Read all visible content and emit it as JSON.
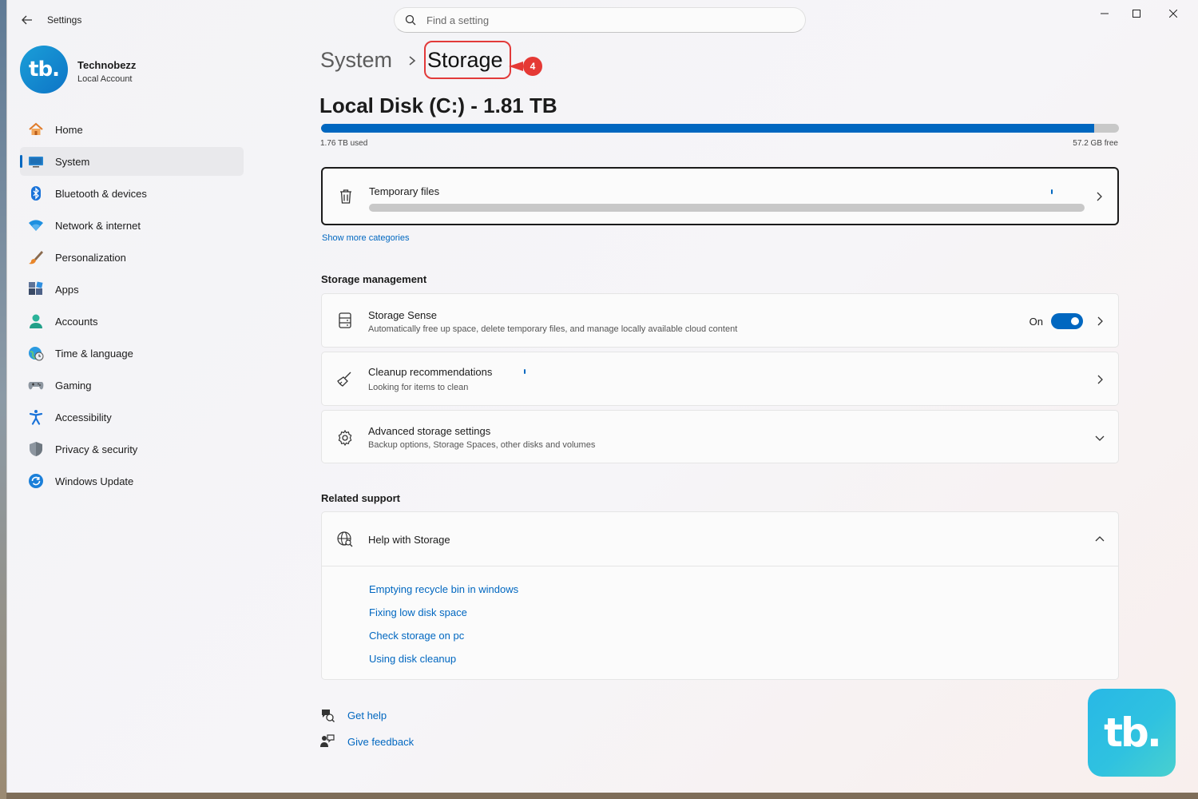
{
  "window": {
    "title": "Settings",
    "search_placeholder": "Find a setting"
  },
  "profile": {
    "avatar_text": "tb.",
    "name": "Technobezz",
    "account_type": "Local Account"
  },
  "sidebar": {
    "items": [
      {
        "label": "Home",
        "icon": "home-icon"
      },
      {
        "label": "System",
        "icon": "system-icon",
        "active": true
      },
      {
        "label": "Bluetooth & devices",
        "icon": "bluetooth-icon"
      },
      {
        "label": "Network & internet",
        "icon": "wifi-icon"
      },
      {
        "label": "Personalization",
        "icon": "brush-icon"
      },
      {
        "label": "Apps",
        "icon": "apps-icon"
      },
      {
        "label": "Accounts",
        "icon": "accounts-icon"
      },
      {
        "label": "Time & language",
        "icon": "globe-clock-icon"
      },
      {
        "label": "Gaming",
        "icon": "gamepad-icon"
      },
      {
        "label": "Accessibility",
        "icon": "accessibility-icon"
      },
      {
        "label": "Privacy & security",
        "icon": "shield-icon"
      },
      {
        "label": "Windows Update",
        "icon": "update-icon"
      }
    ]
  },
  "breadcrumb": {
    "parent": "System",
    "current": "Storage"
  },
  "annotation": {
    "step": "4",
    "color": "#e53935"
  },
  "disk": {
    "title": "Local Disk (C:) - 1.81 TB",
    "used": "1.76 TB used",
    "free": "57.2 GB free",
    "used_fraction": 0.969
  },
  "categories": {
    "temporary_files": "Temporary files",
    "show_more": "Show more categories"
  },
  "storage_management": {
    "heading": "Storage management",
    "storage_sense": {
      "title": "Storage Sense",
      "subtitle": "Automatically free up space, delete temporary files, and manage locally available cloud content",
      "toggle_label": "On",
      "enabled": true
    },
    "cleanup": {
      "title": "Cleanup recommendations",
      "subtitle": "Looking for items to clean"
    },
    "advanced": {
      "title": "Advanced storage settings",
      "subtitle": "Backup options, Storage Spaces, other disks and volumes"
    }
  },
  "related_support": {
    "heading": "Related support",
    "help_title": "Help with Storage",
    "links": [
      "Emptying recycle bin in windows",
      "Fixing low disk space",
      "Check storage on pc",
      "Using disk cleanup"
    ]
  },
  "footer": {
    "get_help": "Get help",
    "give_feedback": "Give feedback"
  },
  "watermark": {
    "text": "tb."
  },
  "colors": {
    "accent": "#0067c0",
    "highlight": "#e23a3a"
  }
}
